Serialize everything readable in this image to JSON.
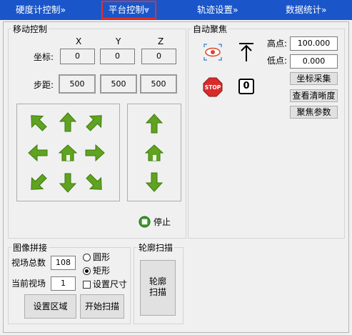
{
  "nav": {
    "items": [
      {
        "label": "硬度计控制»"
      },
      {
        "label": "平台控制⩔"
      },
      {
        "label": "轨迹设置»"
      },
      {
        "label": "数据统计»"
      }
    ],
    "active_color": "#e0302b",
    "bar_color": "#1a56c9"
  },
  "move": {
    "title": "移动控制",
    "axes": [
      "X",
      "Y",
      "Z"
    ],
    "coord_label": "坐标:",
    "coords": [
      "0",
      "0",
      "0"
    ],
    "step_label": "步距:",
    "steps": [
      "500",
      "500",
      "500"
    ],
    "stop_label": "停止"
  },
  "focus": {
    "title": "自动聚焦",
    "high_label": "高点:",
    "high_value": "100.000",
    "low_label": "低点:",
    "low_value": "0.000",
    "counter": "0",
    "stop_badge": "STOP",
    "buttons": [
      "坐标采集",
      "查看清晰度",
      "聚焦参数"
    ]
  },
  "stitch": {
    "title": "图像拼接",
    "total_label": "视场总数",
    "total_value": "108",
    "current_label": "当前视场",
    "current_value": "1",
    "options": [
      "圆形",
      "矩形"
    ],
    "selected": "矩形",
    "size_label": "设置尺寸",
    "set_area_label": "设置区域",
    "start_scan_label": "开始扫描"
  },
  "contour": {
    "title": "轮廓扫描",
    "button_lines": [
      "轮廓",
      "扫描"
    ]
  }
}
